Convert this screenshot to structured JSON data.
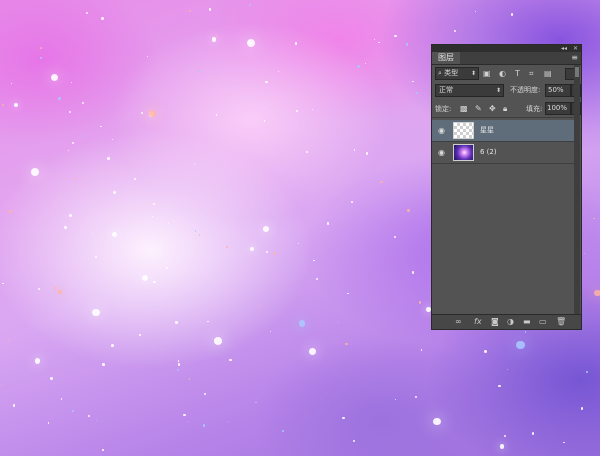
{
  "colors": {
    "panel_bg": "#535353",
    "selected_row": "#5f6d7b",
    "canvas_tint": "#d9a7f2"
  },
  "panel": {
    "title": "图层",
    "menu_icon": "panel-menu-icon",
    "filter": {
      "value": "类型",
      "icons": [
        "image-filter-icon",
        "adjustment-filter-icon",
        "text-filter-icon",
        "shape-filter-icon",
        "smart-object-filter-icon"
      ]
    },
    "blend_mode": "正常",
    "opacity_label": "不透明度:",
    "opacity_value": "50%",
    "lock_label": "锁定:",
    "fill_label": "填充:",
    "fill_value": "100%",
    "layers": [
      {
        "name": "星星",
        "visible": true,
        "selected": true,
        "thumb": "transparent"
      },
      {
        "name": "6 (2)",
        "visible": true,
        "selected": false,
        "thumb": "galaxy"
      }
    ],
    "bottom_icons": [
      "link-icon",
      "fx-icon",
      "mask-icon",
      "adjustment-icon",
      "folder-icon",
      "new-layer-icon",
      "trash-icon"
    ]
  }
}
